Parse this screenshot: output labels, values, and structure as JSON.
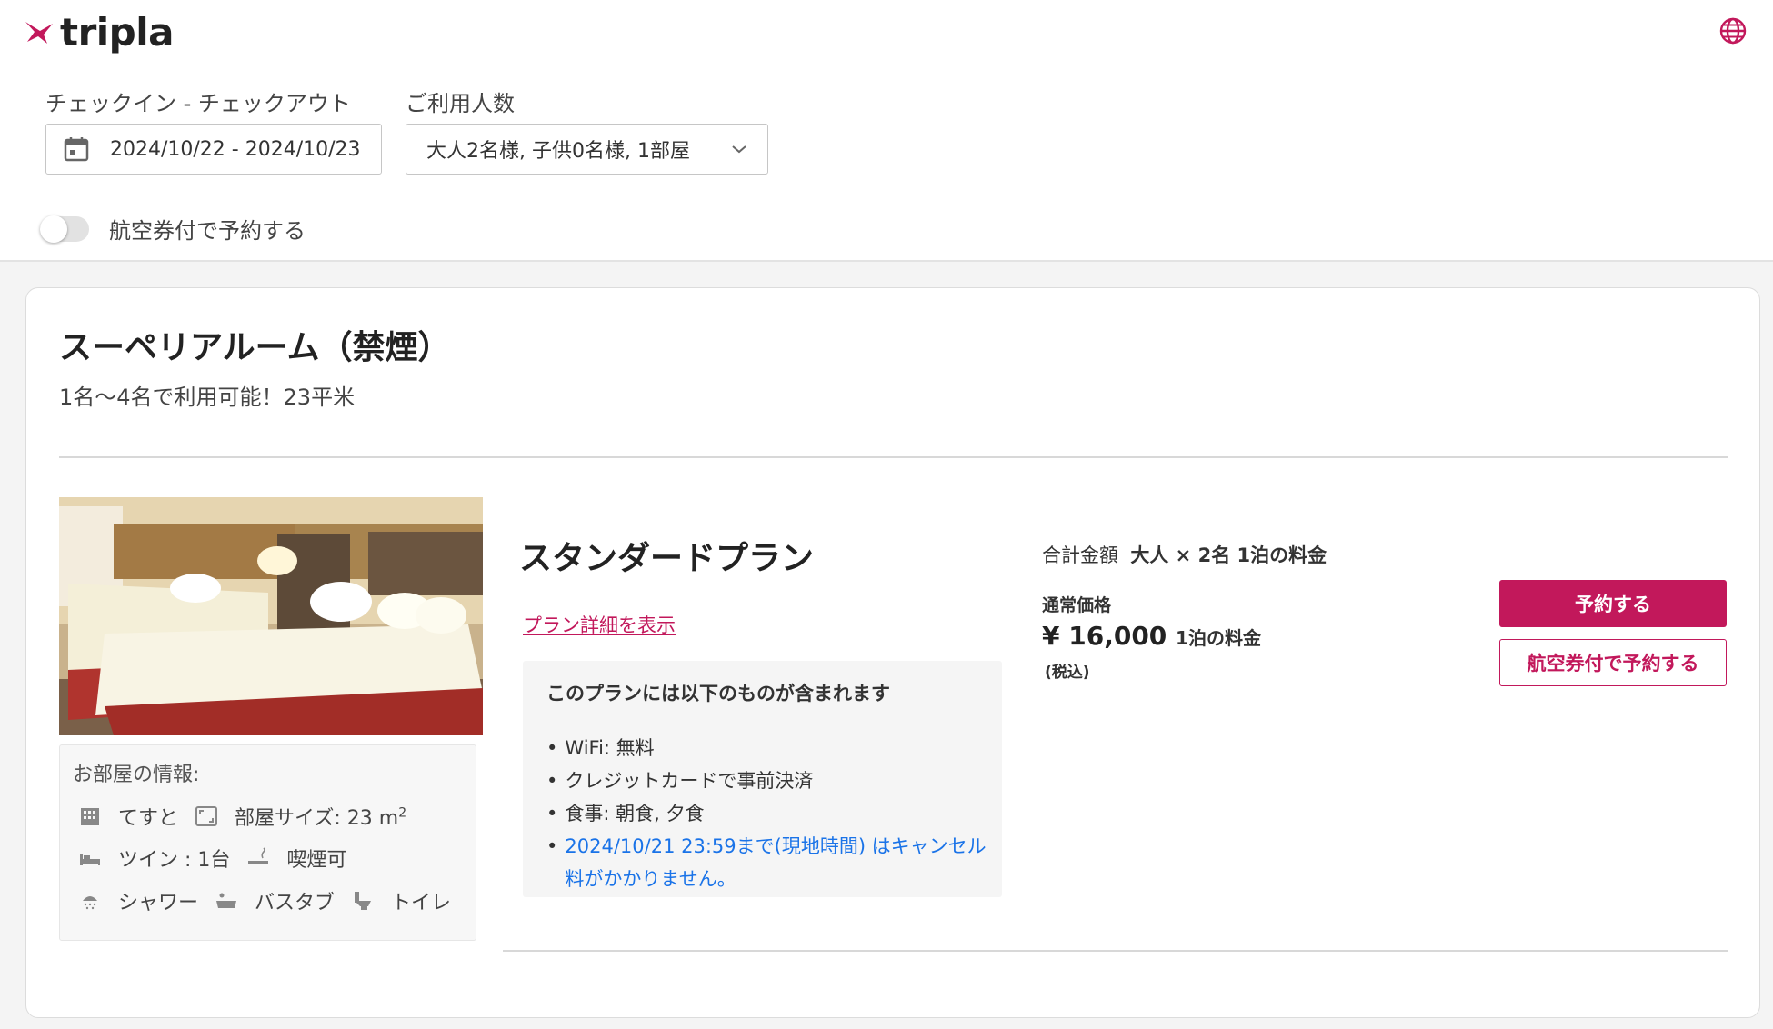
{
  "brand": {
    "name": "tripla",
    "accent": "#c2185b"
  },
  "search": {
    "dates_label": "チェックイン - チェックアウト",
    "dates_value": "2024/10/22 - 2024/10/23",
    "guests_label": "ご利用人数",
    "guests_value": "大人2名様, 子供0名様, 1部屋",
    "flight_toggle_label": "航空券付で予約する",
    "flight_toggle_on": false
  },
  "room": {
    "title": "スーペリアルーム（禁煙）",
    "subtitle": "1名〜4名で利用可能！23平米",
    "info": {
      "title": "お部屋の情報:",
      "building": "てすと",
      "size_label": "部屋サイズ: 23 m",
      "size_sup": "2",
      "bed": "ツイン : 1台",
      "smoking": "喫煙可",
      "shower": "シャワー",
      "bathtub": "バスタブ",
      "toilet": "トイレ"
    }
  },
  "plan": {
    "title": "スタンダードプラン",
    "details_link": "プラン詳細を表示",
    "includes_title": "このプランには以下のものが含まれます",
    "includes": [
      "WiFi: 無料",
      "クレジットカードで事前決済",
      "食事: 朝食, 夕食"
    ],
    "cancel_policy": "2024/10/21 23:59まで(現地時間) はキャンセル料がかかりません。"
  },
  "price": {
    "total_label": "合計金額",
    "total_detail": "大人 × 2名 1泊の料金",
    "normal_label": "通常価格",
    "amount": "¥ 16,000",
    "per_night": "1泊の料金",
    "tax_note": "(税込)"
  },
  "actions": {
    "book": "予約する",
    "book_with_flight": "航空券付で予約する"
  },
  "icons": [
    "tripla-logo-icon",
    "globe-icon",
    "calendar-icon",
    "chevron-down-icon",
    "building-icon",
    "room-size-icon",
    "bed-icon",
    "smoking-icon",
    "shower-icon",
    "bathtub-icon",
    "toilet-icon"
  ]
}
